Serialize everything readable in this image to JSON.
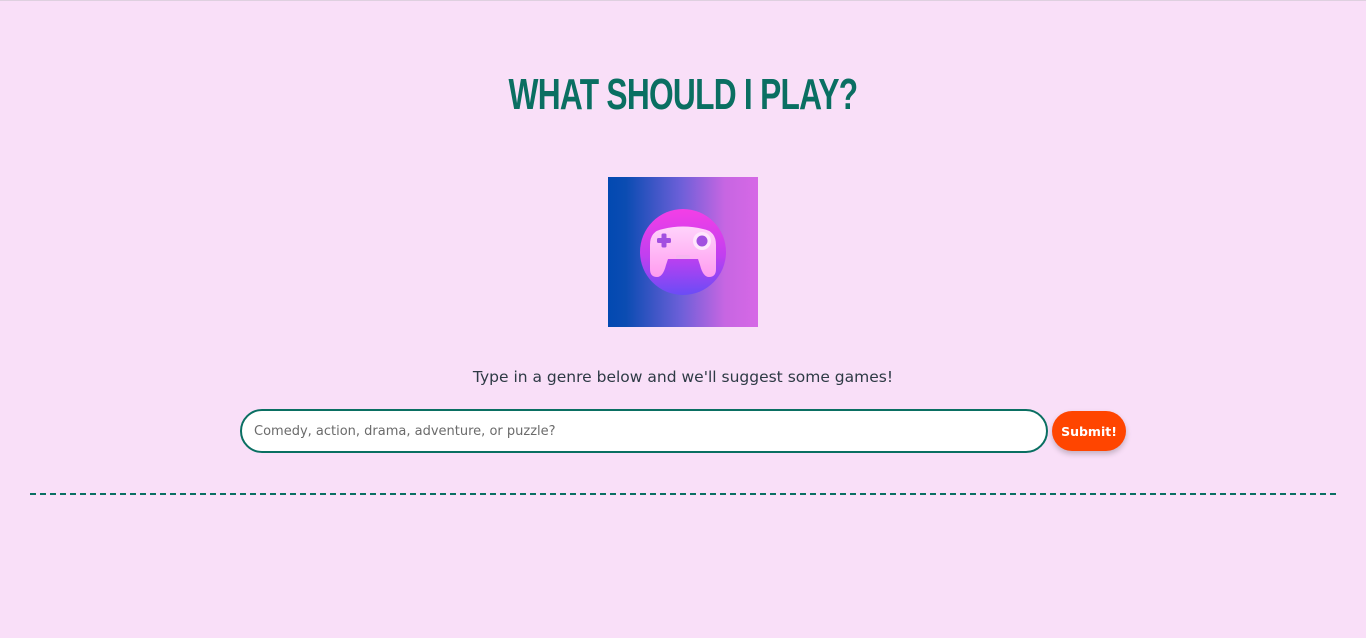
{
  "header": {
    "title": "What should I play?"
  },
  "logo": {
    "icon": "gamepad-icon"
  },
  "prompt": {
    "instructions": "Type in a genre below and we'll suggest some games!"
  },
  "search": {
    "value": "",
    "placeholder": "Comedy, action, drama, adventure, or puzzle?",
    "submit_label": "Submit!"
  },
  "colors": {
    "background": "#f9dff8",
    "title": "#0a6f62",
    "accent": "#ff4500",
    "input_border": "#0a6f62"
  }
}
